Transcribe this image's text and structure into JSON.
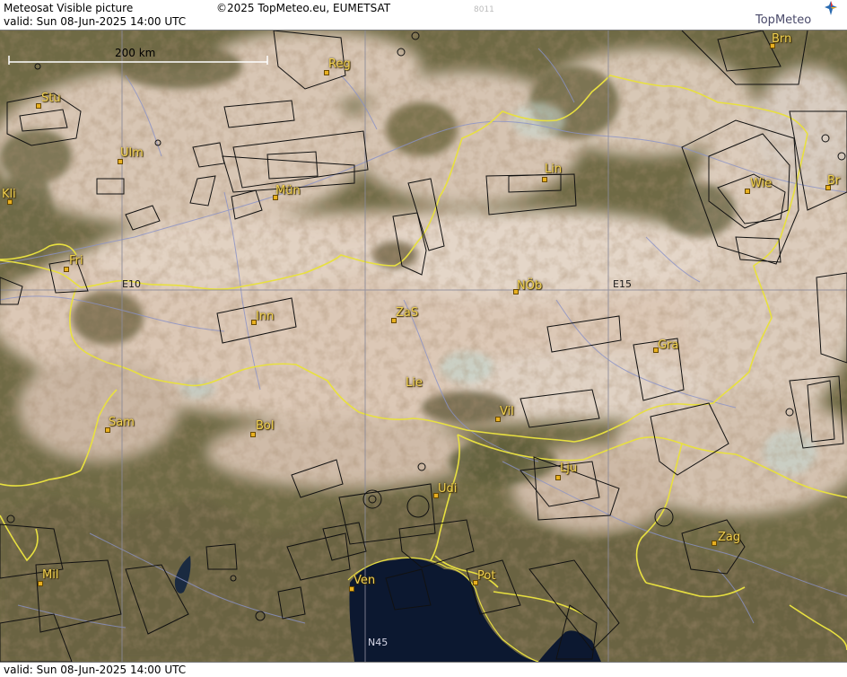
{
  "header": {
    "product": "Meteosat Visible picture",
    "valid": "valid:  Sun  08-Jun-2025  14:00 UTC",
    "copyright": "©2025 TopMeteo.eu, EUMETSAT",
    "file_id": "8011",
    "logo_text": "TopMeteo"
  },
  "footer": {
    "valid": "valid:  Sun  08-Jun-2025  14:00 UTC"
  },
  "map": {
    "scale_label": "200 km",
    "grid_labels": {
      "e10": "E10",
      "e15": "E15",
      "n45": "N45"
    },
    "cities": {
      "stu": "Stu",
      "reg": "Reg",
      "brn": "Brn",
      "ulm": "Ulm",
      "lin": "Lin",
      "mun": "Mün",
      "kli": "Kli",
      "wie": "Wie",
      "bra": "Br",
      "fri": "Fri",
      "nob": "NÖb",
      "inn": "Inn",
      "zas": "ZaS",
      "gra": "Gra",
      "lie": "Lie",
      "vil": "Vil",
      "sam": "Sam",
      "bol": "Bol",
      "lju": "Lju",
      "udi": "Udi",
      "zag": "Zag",
      "mil": "Mil",
      "ven": "Ven",
      "pot": "Pot"
    },
    "colors": {
      "border": "#e8e040",
      "grid": "#8a8a9a",
      "sea": "#0c1830",
      "airspace": "#111111",
      "city": "#f0d050"
    }
  }
}
